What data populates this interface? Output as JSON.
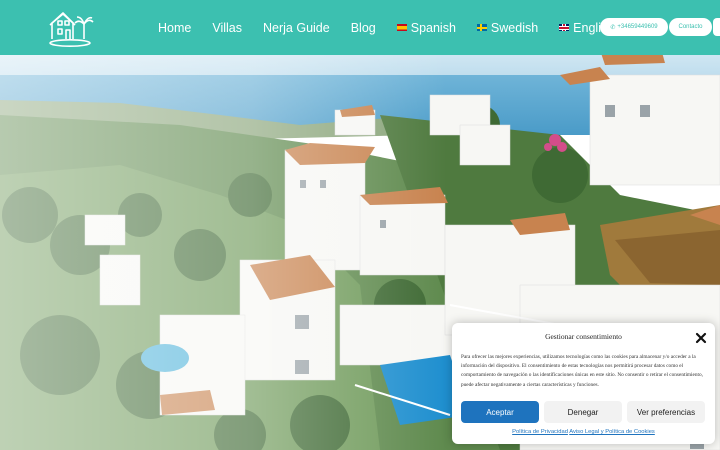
{
  "header": {
    "logo_icon": "villa-house-logo-icon",
    "nav": [
      {
        "label": "Home"
      },
      {
        "label": "Villas"
      },
      {
        "label": "Nerja Guide"
      },
      {
        "label": "Blog"
      },
      {
        "label": "Spanish",
        "flag": "spain-flag-icon"
      },
      {
        "label": "Swedish",
        "flag": "sweden-flag-icon"
      },
      {
        "label": "English",
        "flag": "uk-flag-icon"
      }
    ],
    "phone_label": "+34659449609",
    "phone_icon": "phone-icon",
    "contact_label": "Contacto"
  },
  "hero": {
    "image": "aerial view of white Mediterranean villas on hillside above the sea"
  },
  "consent": {
    "title": "Gestionar consentimiento",
    "body": "Para ofrecer las mejores experiencias, utilizamos tecnologías como las cookies para almacenar y/o acceder a la información del dispositivo. El consentimiento de estas tecnologías nos permitirá procesar datos como el comportamiento de navegación o las identificaciones únicas en este sitio. No consentir o retirar el consentimiento, puede afectar negativamente a ciertas características y funciones.",
    "accept_label": "Aceptar",
    "deny_label": "Denegar",
    "prefs_label": "Ver preferencias",
    "privacy_link": "Política de Privacidad",
    "legal_link": "Aviso Legal y Política de Cookies",
    "link_separator": " "
  },
  "colors": {
    "brand": "#3cc0b0",
    "accept_button": "#1e73be",
    "link": "#1e73be"
  }
}
